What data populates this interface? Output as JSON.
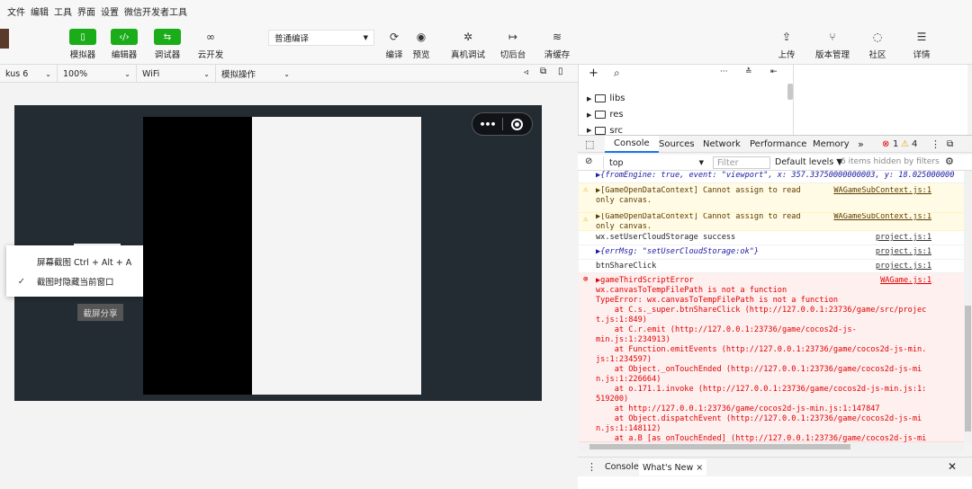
{
  "menubar": [
    "文件",
    "编辑",
    "工具",
    "界面",
    "设置",
    "微信开发者工具"
  ],
  "toolbar": {
    "left_buttons": [
      {
        "label": "模拟器",
        "icon": "phone-icon",
        "glyph": "▯"
      },
      {
        "label": "编辑器",
        "icon": "code-icon",
        "glyph": "‹/›"
      },
      {
        "label": "调试器",
        "icon": "debug-icon",
        "glyph": "⇆"
      },
      {
        "label": "云开发",
        "icon": "cloud-link-icon",
        "glyph": "∞"
      }
    ],
    "compile_mode": "普通编译",
    "actions": [
      {
        "label": "编译",
        "icon": "refresh-icon",
        "glyph": "⟳"
      },
      {
        "label": "预览",
        "icon": "eye-icon",
        "glyph": "◉"
      },
      {
        "label": "真机调试",
        "icon": "bug-icon",
        "glyph": "✲"
      },
      {
        "label": "切后台",
        "icon": "switch-icon",
        "glyph": "↦"
      },
      {
        "label": "清缓存",
        "icon": "layers-icon",
        "glyph": "≋"
      }
    ],
    "right_buttons": [
      {
        "label": "上传",
        "icon": "upload-icon",
        "glyph": "⇪"
      },
      {
        "label": "版本管理",
        "icon": "branch-icon",
        "glyph": "⑂"
      },
      {
        "label": "社区",
        "icon": "chat-icon",
        "glyph": "◌"
      },
      {
        "label": "详情",
        "icon": "menu-icon",
        "glyph": "☰"
      }
    ]
  },
  "device_bar": {
    "device": "kus 6",
    "zoom": "100%",
    "network": "WiFi",
    "operation": "模拟操作"
  },
  "context_menu": {
    "items": [
      {
        "label": "屏幕截图 Ctrl + Alt + A",
        "checked": false
      },
      {
        "label": "截图时隐藏当前窗口",
        "checked": true
      }
    ]
  },
  "share_button": "截屏分享",
  "file_tree": [
    "libs",
    "res",
    "src"
  ],
  "devtools": {
    "tabs": [
      "Console",
      "Sources",
      "Network",
      "Performance",
      "Memory"
    ],
    "more": "»",
    "error_count": "1",
    "warning_count": "4",
    "context": "top",
    "filter_placeholder": "Filter",
    "levels": "Default levels ▼",
    "hidden": "6 items hidden by filters"
  },
  "console": [
    {
      "type": "log",
      "text": "▶{fromEngine: true, event: \"viewport\", x: 357.33750000000003, y: 18.025000000",
      "src": ""
    },
    {
      "type": "warn",
      "text": "▶[GameOpenDataContext] Cannot assign to read\nonly canvas.",
      "src": "WAGameSubContext.js:1"
    },
    {
      "type": "warn",
      "text": "▶[GameOpenDataContext] Cannot assign to read\nonly canvas.",
      "src": "WAGameSubContext.js:1"
    },
    {
      "type": "log",
      "text": "wx.setUserCloudStorage success",
      "src": "project.js:1"
    },
    {
      "type": "log",
      "text": "▶{errMsg: \"setUserCloudStorage:ok\"}",
      "src": "project.js:1"
    },
    {
      "type": "log",
      "text": "btnShareClick",
      "src": "project.js:1"
    },
    {
      "type": "err",
      "text": "▶gameThirdScriptError\nwx.canvasToTempFilePath is not a function\nTypeError: wx.canvasToTempFilePath is not a function\n    at C.s._super.btnShareClick (http://127.0.0.1:23736/game/src/projec\nt.js:1:849)\n    at C.r.emit (http://127.0.0.1:23736/game/cocos2d-js-\nmin.js:1:234913)\n    at Function.emitEvents (http://127.0.0.1:23736/game/cocos2d-js-min.\njs:1:234597)\n    at Object._onTouchEnded (http://127.0.0.1:23736/game/cocos2d-js-mi\nn.js:1:226664)\n    at o.171.1.invoke (http://127.0.0.1:23736/game/cocos2d-js-min.js:1:\n519200)\n    at http://127.0.0.1:23736/game/cocos2d-js-min.js:1:147847\n    at Object.dispatchEvent (http://127.0.0.1:23736/game/cocos2d-js-mi\nn.js:1:148112)\n    at a.B [as onTouchEnded] (http://127.0.0.1:23736/game/cocos2d-js-mi",
      "src": "WAGame.js:1"
    }
  ],
  "drawer": {
    "tabs": [
      "Console",
      "What's New ×"
    ]
  }
}
